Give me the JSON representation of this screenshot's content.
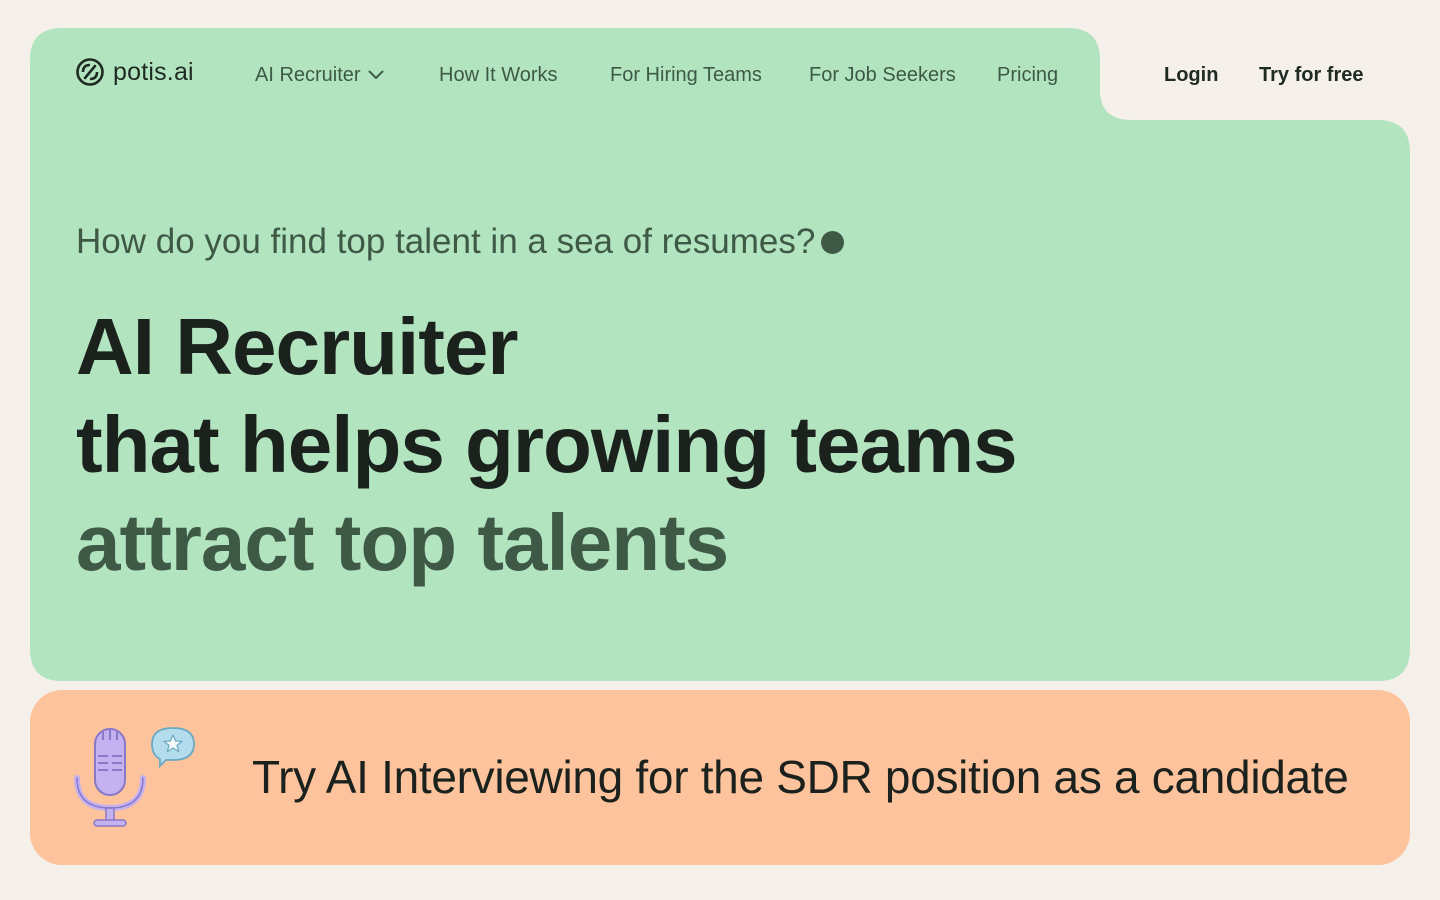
{
  "logo": {
    "text": "potis.ai",
    "icon": "potis-logo-icon"
  },
  "nav": {
    "items": [
      {
        "label": "AI Recruiter",
        "has_dropdown": true
      },
      {
        "label": "How It Works"
      },
      {
        "label": "For Hiring Teams"
      },
      {
        "label": "For Job Seekers"
      },
      {
        "label": "Pricing"
      }
    ],
    "login": "Login",
    "try_free": "Try for free"
  },
  "hero": {
    "tagline": "How do you find top talent in a sea of resumes?",
    "headline": [
      "AI Recruiter",
      "that helps growing teams",
      "attract top talents"
    ]
  },
  "banner": {
    "text": "Try AI Interviewing for the SDR position as a candidate",
    "icon": "microphone-icon",
    "badge_icon": "speech-bubble-star-icon"
  },
  "colors": {
    "page_bg": "#f5f1ea",
    "hero_green": "#b3e4c0",
    "accent_dark_green": "#3e5a47",
    "banner_peach": "#fdc39c",
    "mic_lavender": "#c4b1f0",
    "bubble_blue": "#b3dcec"
  }
}
